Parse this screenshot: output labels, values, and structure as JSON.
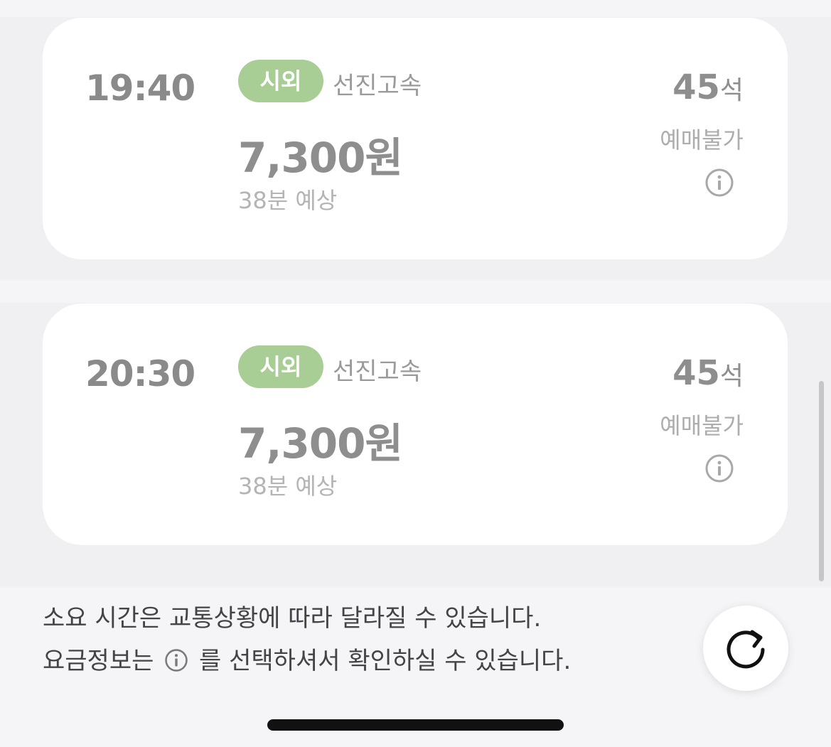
{
  "schedules": [
    {
      "departure_time": "19:40",
      "bus_type": "시외",
      "company": "선진고속",
      "fare": "7,300원",
      "duration": "38분 예상",
      "seats_count": "45",
      "seats_unit": "석",
      "status": "예매불가"
    },
    {
      "departure_time": "20:30",
      "bus_type": "시외",
      "company": "선진고속",
      "fare": "7,300원",
      "duration": "38분 예상",
      "seats_count": "45",
      "seats_unit": "석",
      "status": "예매불가"
    }
  ],
  "notice": {
    "line1": "소요 시간은 교통상황에 따라 달라질 수 있습니다.",
    "line2_prefix": "요금정보는",
    "line2_suffix": "를 선택하셔서 확인하실 수 있습니다."
  },
  "icons": {
    "info": "info-icon",
    "refresh": "refresh-icon"
  },
  "colors": {
    "badge": "#a8cd95",
    "card": "#ffffff",
    "background": "#f5f5f7"
  }
}
